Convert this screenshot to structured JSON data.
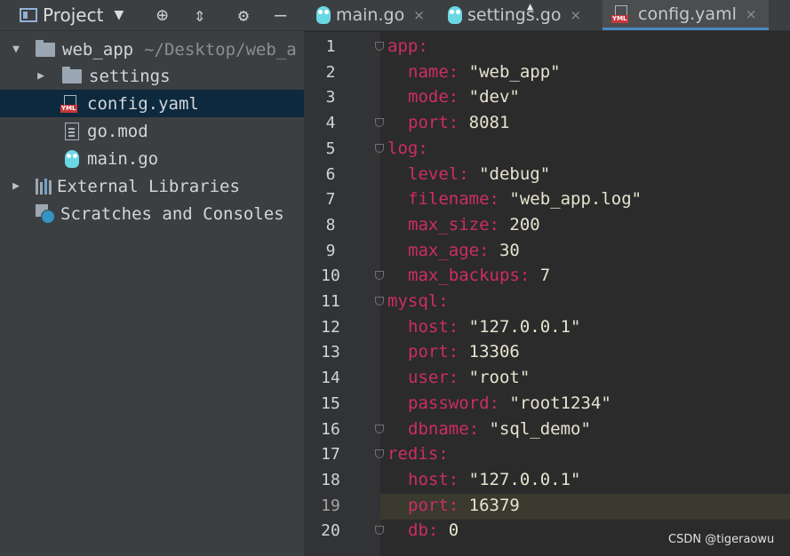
{
  "project_panel": {
    "title": "Project",
    "toolbar_icons": [
      "project-icon",
      "dropdown-icon",
      "locate-icon",
      "collapse-icon",
      "gear-icon",
      "hide-icon"
    ],
    "tree": [
      {
        "label": "web_app",
        "suffix": "~/Desktop/web_a",
        "type": "folder",
        "expanded": true,
        "depth": 0
      },
      {
        "label": "settings",
        "type": "folder",
        "expanded": false,
        "depth": 1
      },
      {
        "label": "config.yaml",
        "type": "yaml",
        "depth": 1,
        "selected": true
      },
      {
        "label": "go.mod",
        "type": "doc",
        "depth": 1
      },
      {
        "label": "main.go",
        "type": "go",
        "depth": 1
      },
      {
        "label": "External Libraries",
        "type": "library",
        "expanded": false,
        "depth": 0
      },
      {
        "label": "Scratches and Consoles",
        "type": "scratch",
        "depth": 0
      }
    ]
  },
  "tabs": [
    {
      "label": "main.go",
      "icon": "gopher-icon"
    },
    {
      "label": "settings.go",
      "icon": "gopher-icon"
    },
    {
      "label": "config.yaml",
      "icon": "yaml-icon",
      "active": true
    }
  ],
  "tab_close": "×",
  "editor": {
    "current_line": 19,
    "lines": [
      {
        "n": "1",
        "indent": 0,
        "key": "app",
        "value": ""
      },
      {
        "n": "2",
        "indent": 1,
        "key": "name",
        "value": "\"web_app\""
      },
      {
        "n": "3",
        "indent": 1,
        "key": "mode",
        "value": "\"dev\""
      },
      {
        "n": "4",
        "indent": 1,
        "key": "port",
        "value": "8081"
      },
      {
        "n": "5",
        "indent": 0,
        "key": "log",
        "value": ""
      },
      {
        "n": "6",
        "indent": 1,
        "key": "level",
        "value": "\"debug\""
      },
      {
        "n": "7",
        "indent": 1,
        "key": "filename",
        "value": "\"web_app.log\""
      },
      {
        "n": "8",
        "indent": 1,
        "key": "max_size",
        "value": "200"
      },
      {
        "n": "9",
        "indent": 1,
        "key": "max_age",
        "value": "30"
      },
      {
        "n": "10",
        "indent": 1,
        "key": "max_backups",
        "value": "7"
      },
      {
        "n": "11",
        "indent": 0,
        "key": "mysql",
        "value": ""
      },
      {
        "n": "12",
        "indent": 1,
        "key": "host",
        "value": "\"127.0.0.1\""
      },
      {
        "n": "13",
        "indent": 1,
        "key": "port",
        "value": "13306"
      },
      {
        "n": "14",
        "indent": 1,
        "key": "user",
        "value": "\"root\""
      },
      {
        "n": "15",
        "indent": 1,
        "key": "password",
        "value": "\"root1234\""
      },
      {
        "n": "16",
        "indent": 1,
        "key": "dbname",
        "value": "\"sql_demo\""
      },
      {
        "n": "17",
        "indent": 0,
        "key": "redis",
        "value": ""
      },
      {
        "n": "18",
        "indent": 1,
        "key": "host",
        "value": "\"127.0.0.1\""
      },
      {
        "n": "19",
        "indent": 1,
        "key": "port",
        "value": "16379"
      },
      {
        "n": "20",
        "indent": 1,
        "key": "db",
        "value": "0"
      }
    ],
    "fold_marker_lines": [
      "1",
      "4",
      "5",
      "10",
      "11",
      "16",
      "17",
      "20"
    ]
  },
  "watermark": "CSDN @tigeraowu",
  "colors": {
    "key": "#cc2d65",
    "value": "#e6e3cf",
    "selection": "#0d293e",
    "tab_underline": "#4a88c7"
  }
}
